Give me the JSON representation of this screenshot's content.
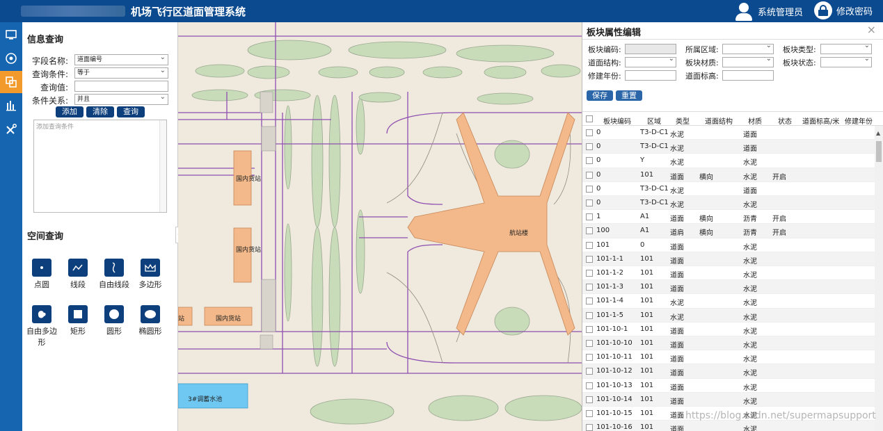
{
  "app": {
    "title": "机场飞行区道面管理系统",
    "user_label": "系统管理员",
    "change_password_label": "修改密码"
  },
  "toolbar": {
    "items": [
      {
        "icon": "monitor-icon"
      },
      {
        "icon": "eye-icon"
      },
      {
        "icon": "layers-icon",
        "active": true
      },
      {
        "icon": "bar-chart-icon"
      },
      {
        "icon": "tools-icon"
      }
    ]
  },
  "info_query": {
    "title": "信息查询",
    "field_name_label": "字段名称:",
    "field_name_value": "道面编号",
    "condition_label": "查询条件:",
    "condition_value": "等于",
    "query_value_label": "查询值:",
    "query_value": "",
    "relation_label": "条件关系:",
    "relation_value": "并且",
    "add_label": "添加",
    "clear_label": "清除",
    "query_label": "查询",
    "conditions_placeholder": "添加查询条件"
  },
  "spatial_query": {
    "title": "空间查询",
    "tools": [
      {
        "label": "点圆",
        "icon": "point-circle-icon"
      },
      {
        "label": "线段",
        "icon": "polyline-icon"
      },
      {
        "label": "自由线段",
        "icon": "freehand-line-icon"
      },
      {
        "label": "多边形",
        "icon": "polygon-icon"
      },
      {
        "label": "自由多边形",
        "icon": "freehand-polygon-icon"
      },
      {
        "label": "矩形",
        "icon": "rectangle-icon"
      },
      {
        "label": "圆形",
        "icon": "circle-icon"
      },
      {
        "label": "椭圆形",
        "icon": "ellipse-icon"
      }
    ]
  },
  "map": {
    "labels": {
      "cargo1": "国内货站",
      "cargo2": "国内货站",
      "cargo3": "国内货站",
      "cargo4": "站",
      "terminal": "航站楼",
      "pool": "3#调蓄水池"
    },
    "colors": {
      "background": "#efe9de",
      "grass": "#c9dcb9",
      "taxiway": "#8e4fb0",
      "building": "#f3b98a",
      "water": "#6ec8f2"
    }
  },
  "editor": {
    "title": "板块属性编辑",
    "close_glyph": "×",
    "fields": {
      "code_label": "板块编码:",
      "region_label": "所属区域:",
      "type_label": "板块类型:",
      "structure_label": "道面结构:",
      "material_label": "板块材质:",
      "status_label": "板块状态:",
      "year_label": "修建年份:",
      "elevation_label": "道面标高:"
    },
    "save_label": "保存",
    "reset_label": "重置",
    "columns": [
      "板块编码",
      "区域",
      "类型",
      "道面结构",
      "材质",
      "状态",
      "道面标高/米",
      "修建年份"
    ],
    "rows": [
      [
        "0",
        "T3-D-C1",
        "水泥",
        "",
        "道面",
        "",
        "",
        ""
      ],
      [
        "0",
        "T3-D-C1",
        "水泥",
        "",
        "道面",
        "",
        "",
        ""
      ],
      [
        "0",
        "Y",
        "水泥",
        "",
        "水泥",
        "",
        "",
        ""
      ],
      [
        "0",
        "101",
        "道面",
        "横向",
        "水泥",
        "开启",
        "",
        ""
      ],
      [
        "0",
        "T3-D-C1",
        "水泥",
        "",
        "道面",
        "",
        "",
        ""
      ],
      [
        "0",
        "T3-D-C1",
        "水泥",
        "",
        "水泥",
        "",
        "",
        ""
      ],
      [
        "1",
        "A1",
        "道面",
        "横向",
        "沥青",
        "开启",
        "",
        ""
      ],
      [
        "100",
        "A1",
        "道肩",
        "横向",
        "沥青",
        "开启",
        "",
        ""
      ],
      [
        "101",
        "0",
        "道面",
        "",
        "水泥",
        "",
        "",
        ""
      ],
      [
        "101-1-1",
        "101",
        "道面",
        "",
        "水泥",
        "",
        "",
        ""
      ],
      [
        "101-1-2",
        "101",
        "道面",
        "",
        "水泥",
        "",
        "",
        ""
      ],
      [
        "101-1-3",
        "101",
        "道面",
        "",
        "水泥",
        "",
        "",
        ""
      ],
      [
        "101-1-4",
        "101",
        "水泥",
        "",
        "水泥",
        "",
        "",
        ""
      ],
      [
        "101-1-5",
        "101",
        "水泥",
        "",
        "水泥",
        "",
        "",
        ""
      ],
      [
        "101-10-1",
        "101",
        "道面",
        "",
        "水泥",
        "",
        "",
        ""
      ],
      [
        "101-10-10",
        "101",
        "道面",
        "",
        "水泥",
        "",
        "",
        ""
      ],
      [
        "101-10-11",
        "101",
        "道面",
        "",
        "水泥",
        "",
        "",
        ""
      ],
      [
        "101-10-12",
        "101",
        "道面",
        "",
        "水泥",
        "",
        "",
        ""
      ],
      [
        "101-10-13",
        "101",
        "道面",
        "",
        "水泥",
        "",
        "",
        ""
      ],
      [
        "101-10-14",
        "101",
        "道面",
        "",
        "水泥",
        "",
        "",
        ""
      ],
      [
        "101-10-15",
        "101",
        "道面",
        "",
        "水泥",
        "",
        "",
        ""
      ],
      [
        "101-10-16",
        "101",
        "道面",
        "",
        "水泥",
        "",
        "",
        ""
      ]
    ]
  },
  "watermark": "https://blog.csdn.net/supermapsupport"
}
